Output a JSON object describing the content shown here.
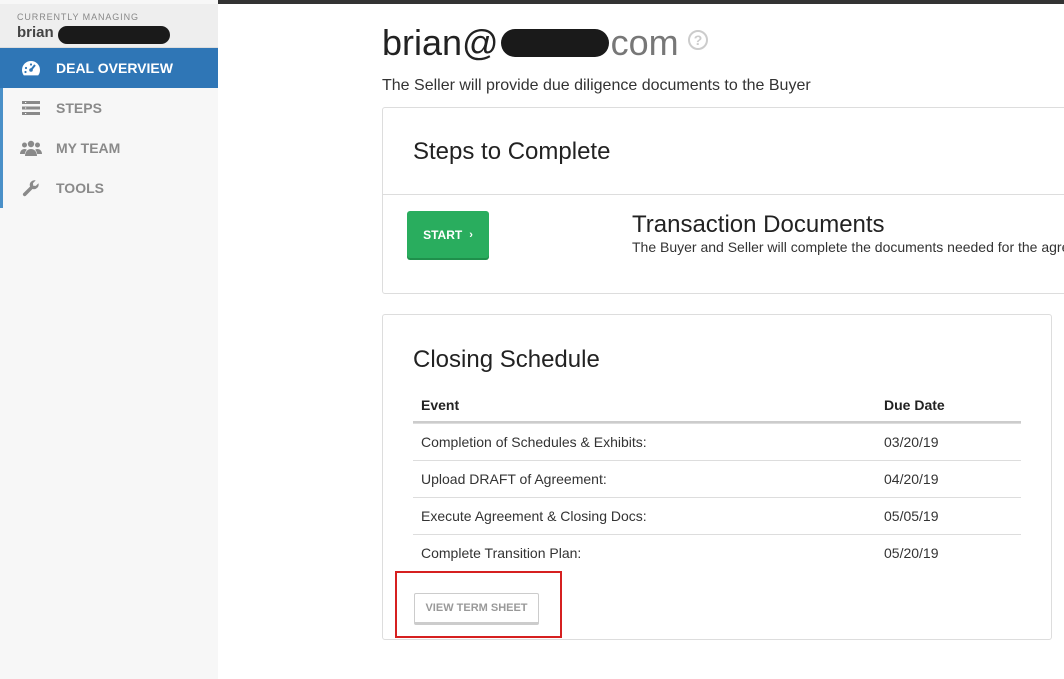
{
  "sidebar": {
    "managing_caption": "CURRENTLY MANAGING",
    "managing_user": "brian",
    "items": [
      {
        "label": "DEAL OVERVIEW",
        "icon": "dashboard-icon",
        "active": true
      },
      {
        "label": "STEPS",
        "icon": "list-icon"
      },
      {
        "label": "MY TEAM",
        "icon": "users-icon"
      },
      {
        "label": "TOOLS",
        "icon": "wrench-icon"
      }
    ]
  },
  "header": {
    "title_prefix": "brian@",
    "title_suffix": "com",
    "subtitle": "The Seller will provide due diligence documents to the Buyer"
  },
  "steps": {
    "heading": "Steps to Complete",
    "start_label": "START",
    "doc_title": "Transaction Documents",
    "doc_desc": "The Buyer and Seller will complete the documents needed for the agre"
  },
  "schedule": {
    "heading": "Closing Schedule",
    "columns": [
      "Event",
      "Due Date"
    ],
    "rows": [
      {
        "event": "Completion of Schedules & Exhibits:",
        "due": "03/20/19"
      },
      {
        "event": "Upload DRAFT of Agreement:",
        "due": "04/20/19"
      },
      {
        "event": "Execute Agreement & Closing Docs:",
        "due": "05/05/19"
      },
      {
        "event": "Complete Transition Plan:",
        "due": "05/20/19"
      }
    ],
    "term_sheet_label": "VIEW TERM SHEET"
  },
  "colors": {
    "nav_active": "#2f76b6",
    "start_button": "#29ad5e",
    "highlight": "#d62020"
  }
}
